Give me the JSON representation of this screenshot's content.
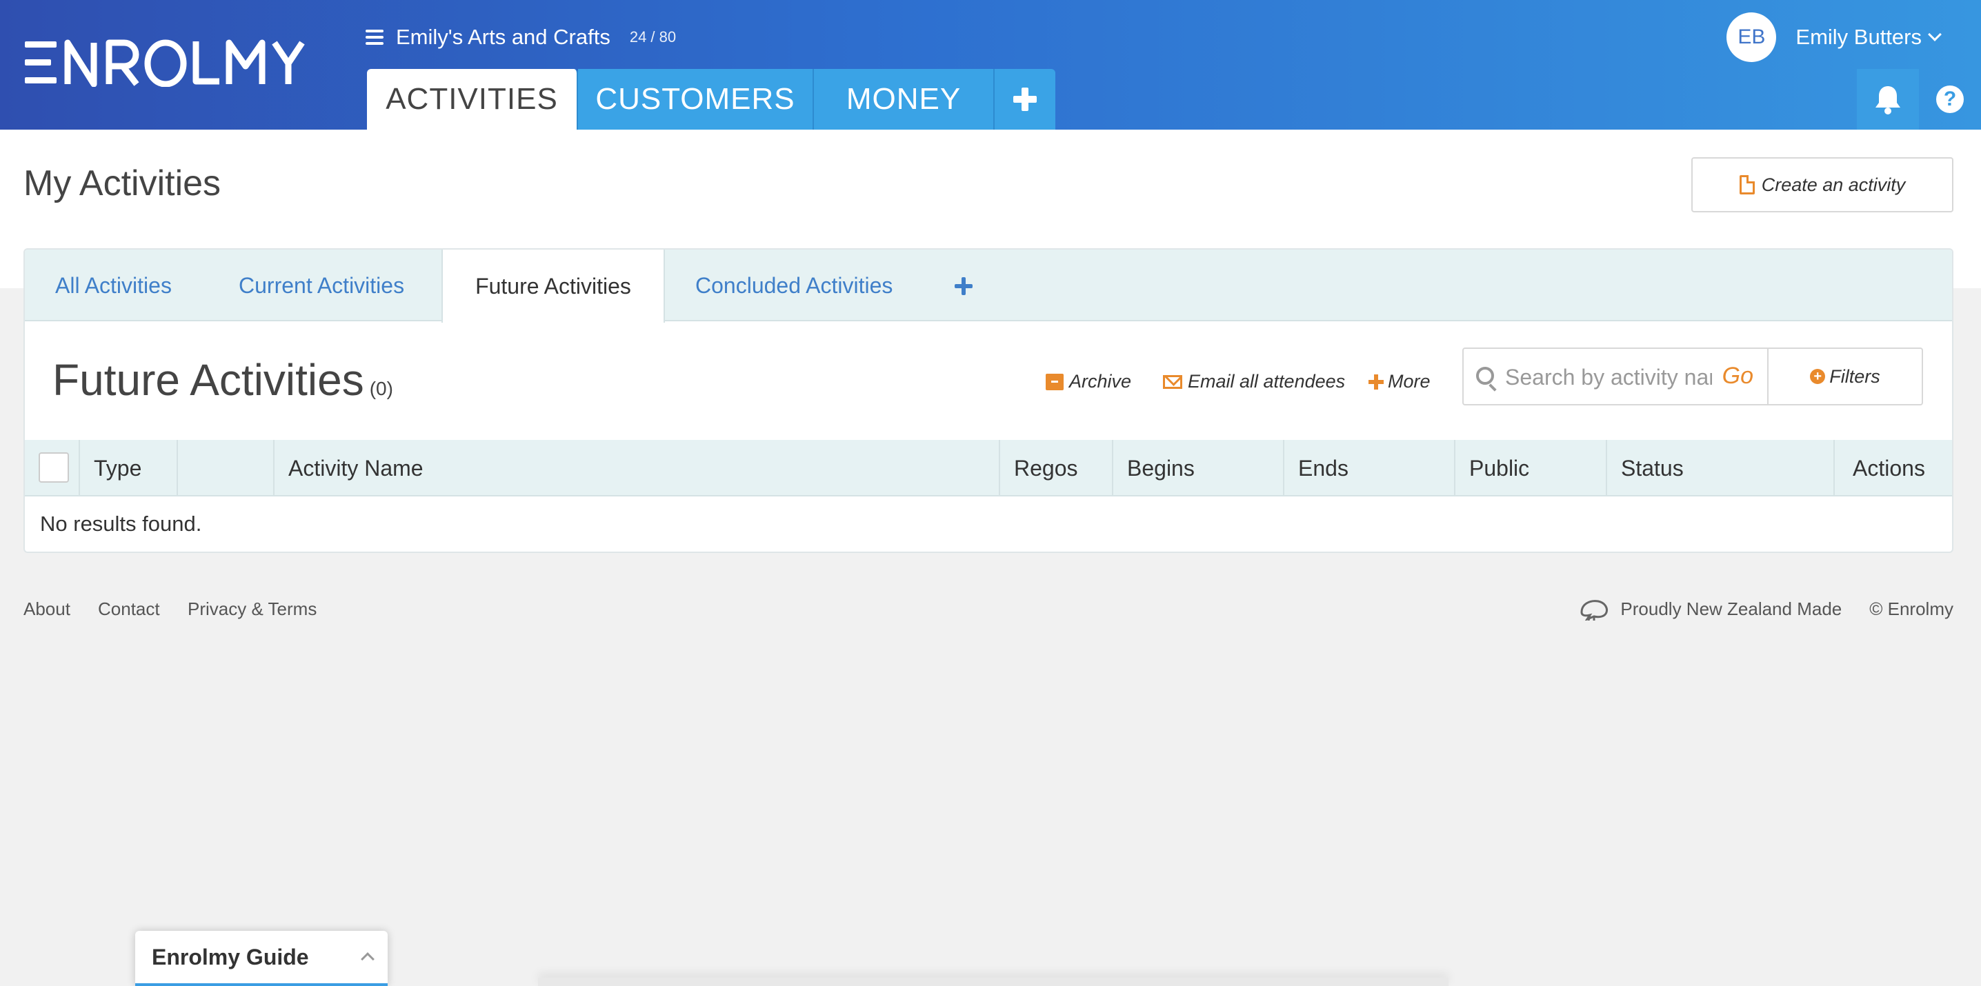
{
  "header": {
    "org_name": "Emily's Arts and Crafts",
    "org_count": "24 / 80",
    "tabs": [
      {
        "label": "ACTIVITIES"
      },
      {
        "label": "CUSTOMERS"
      },
      {
        "label": "MONEY"
      }
    ],
    "user": {
      "initials": "EB",
      "name": "Emily Butters"
    },
    "help_label": "?"
  },
  "page": {
    "title": "My Activities",
    "create_label": "Create an activity"
  },
  "sub_tabs": [
    {
      "label": "All Activities"
    },
    {
      "label": "Current Activities"
    },
    {
      "label": "Future Activities"
    },
    {
      "label": "Concluded Activities"
    }
  ],
  "section": {
    "title": "Future Activities",
    "count": "(0)",
    "archive_label": "Archive",
    "email_label": "Email all attendees",
    "more_label": "More",
    "search_placeholder": "Search by activity name",
    "go_label": "Go",
    "filters_label": "Filters"
  },
  "table": {
    "columns": [
      "Type",
      "",
      "Activity Name",
      "Regos",
      "Begins",
      "Ends",
      "Public",
      "Status",
      "Actions"
    ],
    "empty_text": "No results found."
  },
  "footer": {
    "links": [
      "About",
      "Contact",
      "Privacy & Terms"
    ],
    "made_in": "Proudly New Zealand Made",
    "copyright": "© Enrolmy"
  },
  "guide": {
    "title": "Enrolmy Guide"
  },
  "colors": {
    "accent": "#e98a2c",
    "link": "#3f7fc9",
    "header_start": "#2f4fb0",
    "header_end": "#3796e0"
  }
}
